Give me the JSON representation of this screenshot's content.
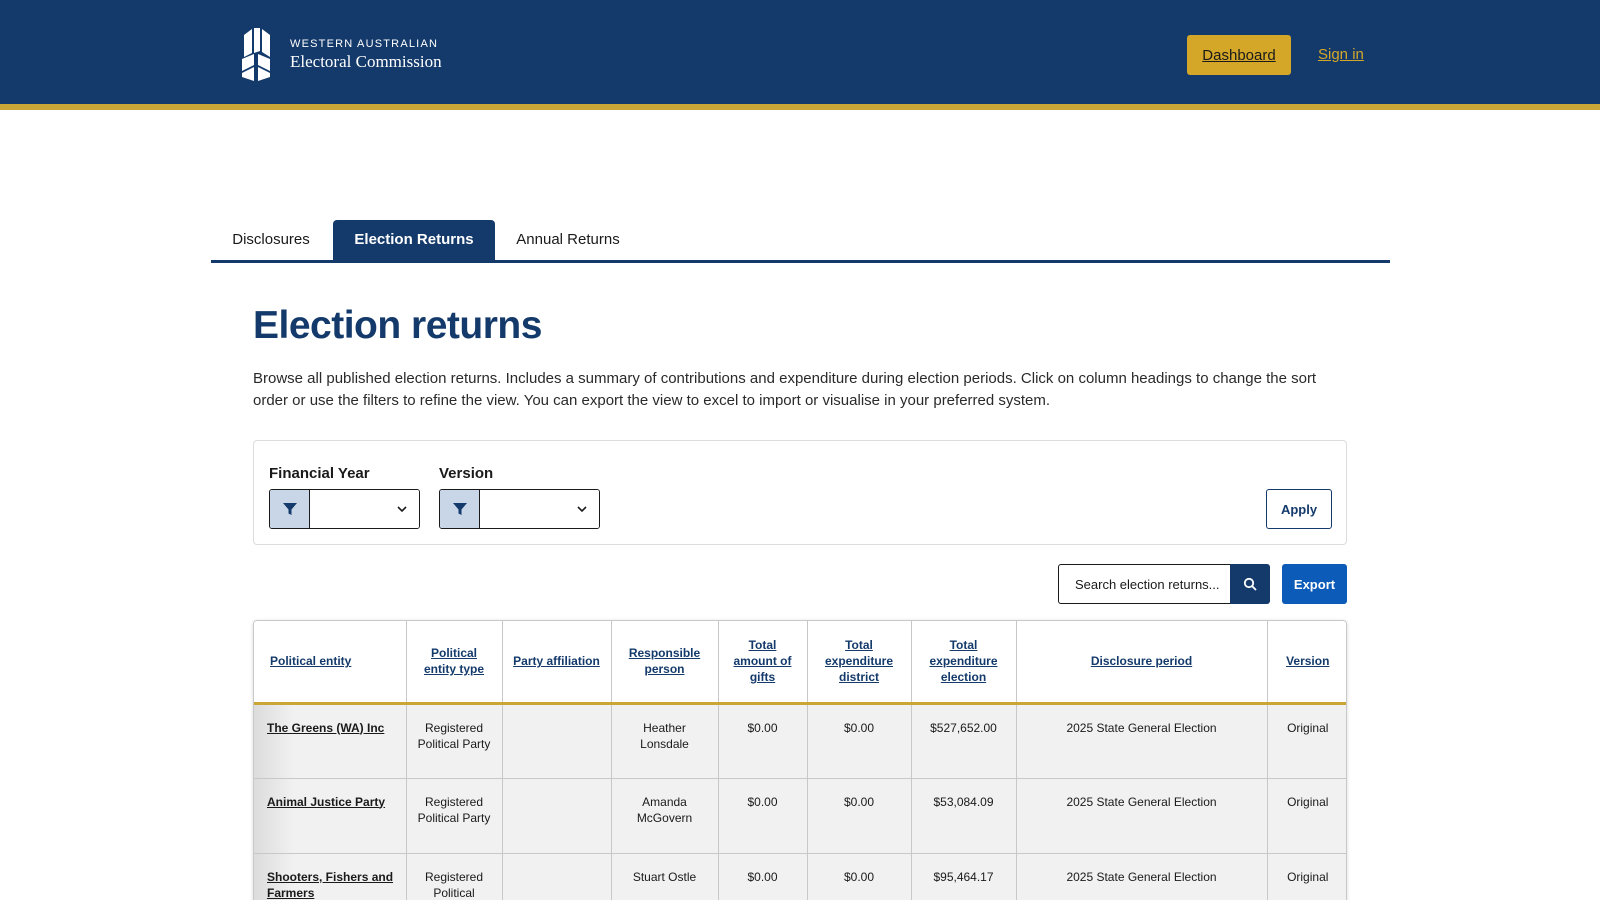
{
  "header": {
    "logo_line1": "WESTERN AUSTRALIAN",
    "logo_line2": "Electoral Commission",
    "dashboard_label": "Dashboard",
    "signin_label": "Sign in",
    "bg_color": "#143a6b",
    "accent_color": "#c9a635"
  },
  "tabs": [
    {
      "label": "Disclosures",
      "active": false
    },
    {
      "label": "Election Returns",
      "active": true
    },
    {
      "label": "Annual Returns",
      "active": false
    }
  ],
  "page": {
    "title": "Election returns",
    "description": "Browse all published election returns. Includes a summary of  contributions and expenditure during election periods. Click on column headings to change the sort order or use the filters to refine the view. You can export the view to excel to import or visualise in your preferred system."
  },
  "filters": {
    "financial_year_label": "Financial Year",
    "financial_year_value": "",
    "version_label": "Version",
    "version_value": "",
    "apply_label": "Apply"
  },
  "search": {
    "placeholder": "Search election returns...",
    "icon": "search-icon",
    "export_label": "Export"
  },
  "table": {
    "columns": [
      "Political entity",
      "Political entity type",
      "Party affiliation",
      "Responsible person",
      "Total amount of gifts",
      "Total expenditure district",
      "Total expenditure election",
      "Disclosure period",
      "Version"
    ],
    "rows": [
      {
        "entity": "The Greens (WA) Inc",
        "type": "Registered Political Party",
        "affiliation": "",
        "person": "Heather Lonsdale",
        "gifts": "$0.00",
        "exp_district": "$0.00",
        "exp_election": "$527,652.00",
        "period": "2025 State General Election",
        "version": "Original"
      },
      {
        "entity": "Animal Justice Party",
        "type": "Registered Political Party",
        "affiliation": "",
        "person": "Amanda McGovern",
        "gifts": "$0.00",
        "exp_district": "$0.00",
        "exp_election": "$53,084.09",
        "period": "2025 State General Election",
        "version": "Original"
      },
      {
        "entity": "Shooters, Fishers and Farmers",
        "type": "Registered Political",
        "affiliation": "",
        "person": "Stuart Ostle",
        "gifts": "$0.00",
        "exp_district": "$0.00",
        "exp_election": "$95,464.17",
        "period": "2025 State General Election",
        "version": "Original"
      }
    ]
  }
}
